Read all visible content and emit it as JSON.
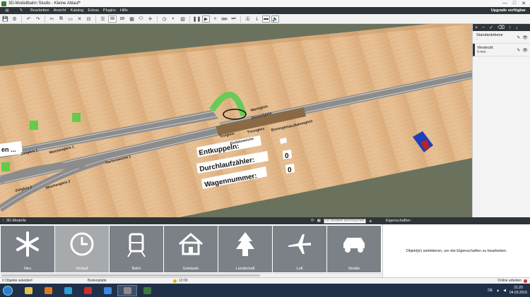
{
  "title_bar": {
    "title": "3D-Modellbahn Studio - Kleine Ablauf*",
    "controls": [
      "—",
      "□",
      "✕"
    ]
  },
  "menu": {
    "items": [
      "Bearbeiten",
      "Ansicht",
      "Katalog",
      "Extras",
      "Plugins",
      "Hilfe"
    ],
    "upgrade_label": "Upgrade verfügbar"
  },
  "toolbar": {
    "mode_3d": "3D",
    "mode_2d": "2D"
  },
  "scene": {
    "labels": {
      "wartegleis": "Wartegleis",
      "drossel": "Drosselgleis",
      "auffahr": "Auffahrtsgleis",
      "testgleis": "Testgleis",
      "trenngleis": "Trenngleis",
      "bremsgleis": "Bremsgleis",
      "einfahr": "Einfahrweiche",
      "ziel1": "Zielgleis 1",
      "weichen1": "Weichengleis 1",
      "harfen": "Harfenweiche 1",
      "ziel2": "Zielgleis 2",
      "weichen2": "Weichengleis 2",
      "sign_partial": "en ..."
    },
    "counters": {
      "entkuppeln_label": "Entkuppeln:",
      "durchlauf_label": "Durchlaufzähler:",
      "wagen_label": "Wagennummer:",
      "entkuppeln_value": "0",
      "durchlauf_value": "0"
    }
  },
  "layers": {
    "items": [
      {
        "name": "Standardebene",
        "sub": "-"
      },
      {
        "name": "Versteckt",
        "sub": "0 mm"
      }
    ]
  },
  "bottom": {
    "header_label": "3D-Modelle",
    "search_placeholder": "3D-Modelle durchsuchen",
    "properties_label": "Eigenschaften",
    "properties_hint": "Objekt(e) selektieren, um die Eigenschaften zu bearbeiten.",
    "categories": [
      "Neu",
      "Verlauf",
      "Bahn",
      "Gebäude",
      "Landschaft",
      "Luft",
      "Straße"
    ]
  },
  "status": {
    "selected": "0 Objekte selektiert",
    "object": "Bodenplatte",
    "time": "12:00",
    "online": "Online arbeiten"
  },
  "taskbar": {
    "lang": "DE",
    "time": "21:20",
    "date": "04.03.2016"
  }
}
